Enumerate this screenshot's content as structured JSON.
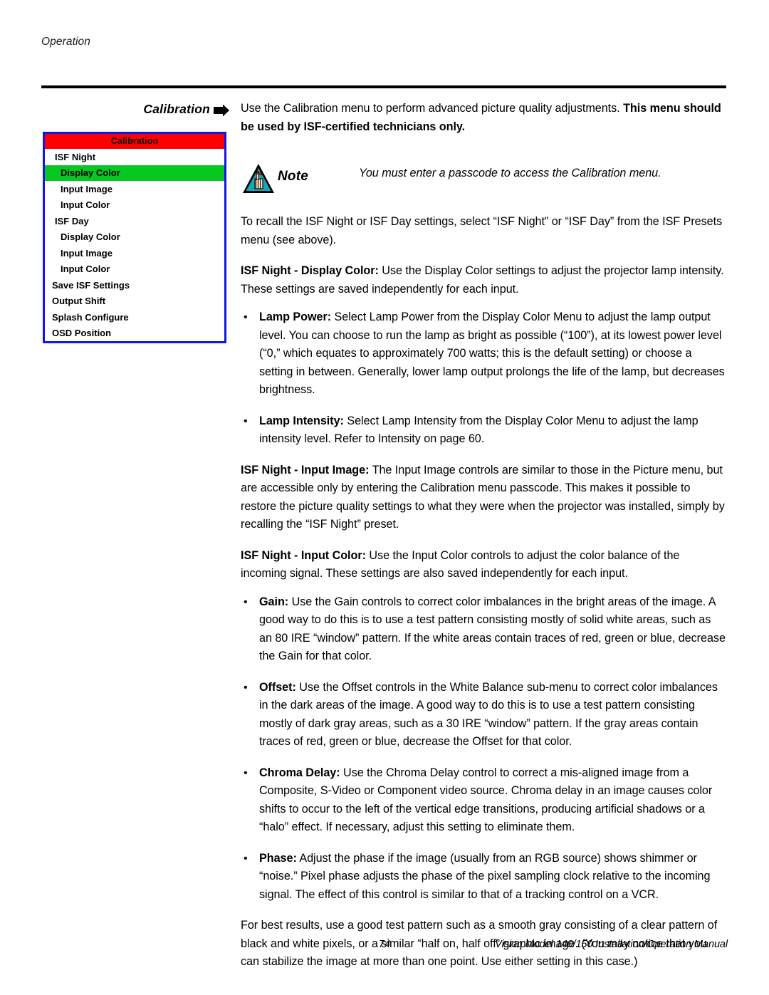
{
  "header": {
    "running_head": "Operation"
  },
  "section_marker": {
    "label": "Calibration",
    "arrow_icon": "right-arrow-icon"
  },
  "osd_menu": {
    "title": "Calibration",
    "items": [
      {
        "label": "ISF Night",
        "level": 1,
        "selected": false
      },
      {
        "label": "Display Color",
        "level": 2,
        "selected": true
      },
      {
        "label": "Input Image",
        "level": 2,
        "selected": false
      },
      {
        "label": "Input Color",
        "level": 2,
        "selected": false
      },
      {
        "label": "ISF Day",
        "level": 1,
        "selected": false
      },
      {
        "label": "Display Color",
        "level": 2,
        "selected": false
      },
      {
        "label": "Input Image",
        "level": 2,
        "selected": false
      },
      {
        "label": "Input Color",
        "level": 2,
        "selected": false
      },
      {
        "label": "Save ISF Settings",
        "level": 0,
        "selected": false
      },
      {
        "label": "Output Shift",
        "level": 0,
        "selected": false
      },
      {
        "label": "Splash Configure",
        "level": 0,
        "selected": false
      },
      {
        "label": "OSD Position",
        "level": 0,
        "selected": false
      }
    ],
    "colors": {
      "border": "#1414e6",
      "title_bg": "#fe0000",
      "selected_bg": "#07c722",
      "row_bg": "#ffffff",
      "text": "#000000"
    }
  },
  "body": {
    "intro_plain": "Use the Calibration menu to perform advanced picture quality adjustments. ",
    "intro_bold": "This menu should be used by ISF-certified technicians only.",
    "note": {
      "icon": "note-hand-triangle-icon",
      "word": "Note",
      "text": "You must enter a passcode to access the Calibration menu."
    },
    "recall_para": "To recall the ISF Night or ISF Day settings, select “ISF Night” or “ISF Day” from the ISF Presets menu (see above).",
    "display_color_lead": "ISF Night - Display Color:",
    "display_color_body": " Use the Display Color settings to adjust the projector lamp intensity. These settings are saved independently for each input.",
    "bullets_display": [
      {
        "lead": "Lamp Power:",
        "body": " Select Lamp Power from the Display Color Menu to adjust the lamp output level. You can choose to run the lamp as bright as possible (“100”), at its lowest power level (“0,” which equates to approximately 700 watts; this is the default setting) or choose a setting in between. Generally, lower lamp output prolongs the life of the lamp, but decreases brightness."
      }
    ],
    "lamp_intensity": {
      "lead": "Lamp Intensity:",
      "body_1": " Select Lamp Intensity from the Display Color Menu to adjust the lamp intensity level. Refer to ",
      "emph": "Intensity",
      "body_2": " on page 60."
    },
    "input_image_lead": "ISF Night - Input Image:",
    "input_image_body": " The Input Image controls are similar to those in the Picture menu, but are accessible only by entering the Calibration menu passcode. This makes it possible to restore the picture quality settings to what they were when the projector was installed, simply by recalling the “ISF Night” preset.",
    "input_color_lead": "ISF Night - Input Color:",
    "input_color_body": " Use the Input Color controls to adjust the color balance of the incoming signal. These settings are also saved independently for each input.",
    "bullets_input_color": [
      {
        "lead": "Gain:",
        "body": " Use the Gain controls to correct color imbalances in the bright areas of the image. A good way to do this is to use a test pattern consisting mostly of solid white areas, such as an 80 IRE “window” pattern. If the white areas contain traces of red, green or blue, decrease the Gain for that color."
      },
      {
        "lead": "Offset:",
        "body": " Use the Offset controls in the White Balance sub-menu to correct color imbalances in the dark areas of the image. A good way to do this is to use a test pattern consisting mostly of dark gray areas, such as a 30 IRE “window” pattern. If the gray areas contain traces of red, green or blue, decrease the Offset for that color."
      },
      {
        "lead": "Chroma Delay:",
        "body": " Use the Chroma Delay control to correct a mis-aligned image from a Composite, S-Video or Component video source. Chroma delay in an image causes color shifts to occur to the left of the vertical edge transitions, producing artificial shadows or a “halo” effect. If necessary, adjust this setting to eliminate them."
      },
      {
        "lead": "Phase:",
        "body": " Adjust the phase if the image (usually from an RGB source) shows shimmer or “noise.” Pixel phase adjusts the phase of the pixel sampling clock relative to the incoming signal. The effect of this control is similar to that of a tracking control on a VCR."
      }
    ],
    "closing_para": "For best results, use a good test pattern such as a smooth gray consisting of a clear pattern of black and white pixels, or a similar “half on, half off” graphic image. (You may notice that you can stabilize the image at more than one point. Use either setting in this case.)"
  },
  "footer": {
    "page_number": "74",
    "manual_title": "Vision Model 140/150 Installation/Operation Manual"
  },
  "bullet_glyph": "•"
}
